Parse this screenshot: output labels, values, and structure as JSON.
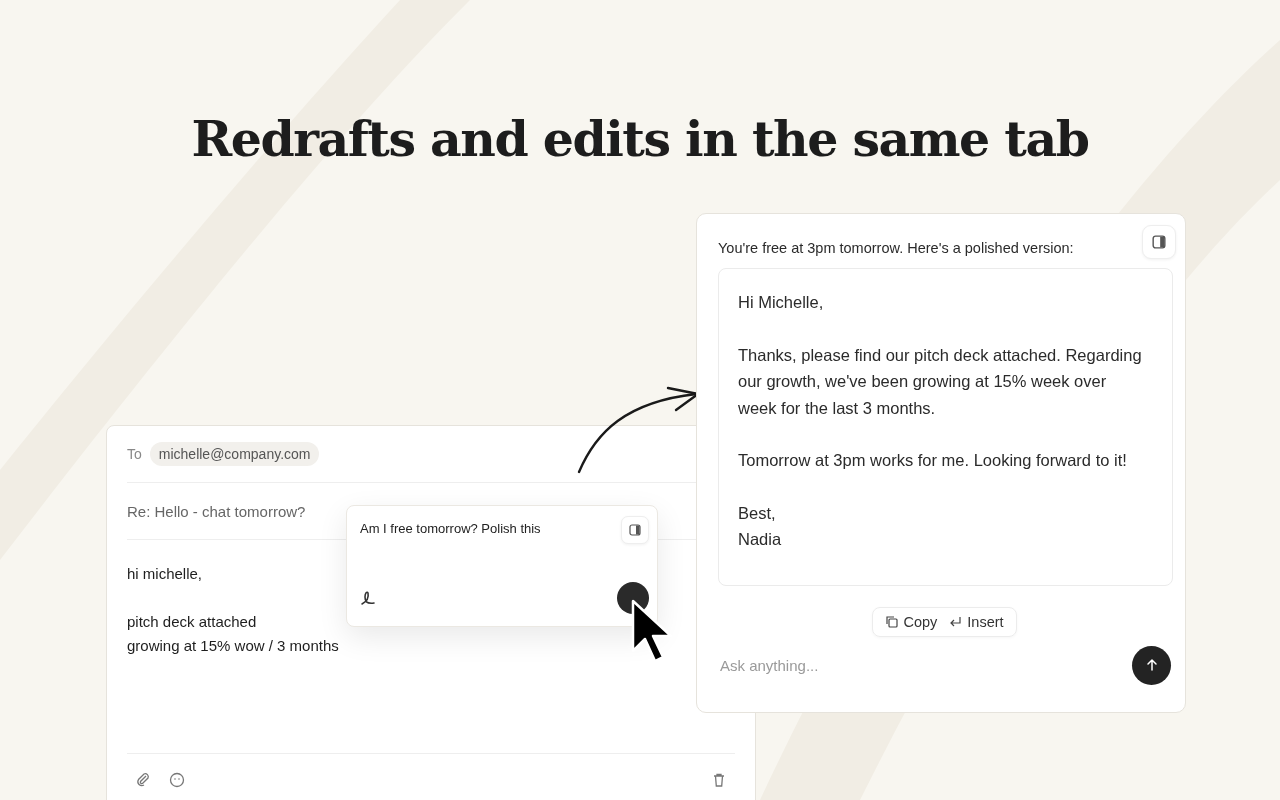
{
  "headline": "Redrafts and edits in the same tab",
  "email": {
    "to_label": "To",
    "recipient": "michelle@company.com",
    "subject": "Re: Hello - chat tomorrow?",
    "paragraphs": [
      [
        "hi michelle,"
      ],
      [
        "pitch deck attached",
        "growing at 15% wow / 3 months"
      ]
    ]
  },
  "prompt_popup": {
    "text": "Am I free tomorrow? Polish this"
  },
  "chat": {
    "message": "You're free at 3pm tomorrow. Here's a polished version:",
    "draft": [
      "Hi Michelle,",
      "Thanks, please find our pitch deck attached. Regarding our growth, we've been growing at 15% week over week for the last 3 months.",
      "Tomorrow at 3pm works for me. Looking forward to it!",
      "Best,\nNadia"
    ],
    "actions": [
      {
        "kind": "copy",
        "label": "Copy"
      },
      {
        "kind": "insert",
        "label": "Insert"
      }
    ],
    "input": {
      "placeholder": "Ask anything..."
    }
  }
}
